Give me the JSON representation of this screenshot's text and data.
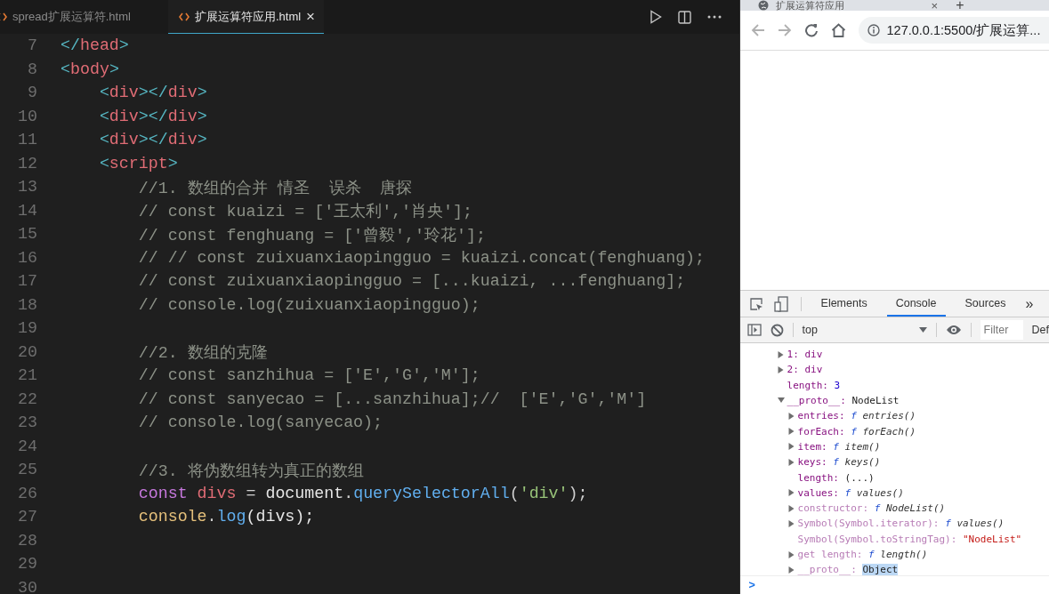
{
  "editor": {
    "tabs": [
      {
        "label": "spread扩展运算符.html",
        "selected": false,
        "closable": false
      },
      {
        "label": "扩展运算符应用.html",
        "selected": true,
        "closable": true,
        "close": "×"
      }
    ],
    "lines": [
      {
        "number": "7",
        "tokens": [
          {
            "text": "</",
            "kind": "bracket"
          },
          {
            "text": "head",
            "kind": "tag"
          },
          {
            "text": ">",
            "kind": "bracket"
          }
        ]
      },
      {
        "number": "8",
        "tokens": [
          {
            "text": "<",
            "kind": "bracket"
          },
          {
            "text": "body",
            "kind": "tag"
          },
          {
            "text": ">",
            "kind": "bracket"
          }
        ]
      },
      {
        "number": "9",
        "tokens": [
          {
            "text": "    <",
            "kind": "bracket"
          },
          {
            "text": "div",
            "kind": "tag"
          },
          {
            "text": "></",
            "kind": "bracket"
          },
          {
            "text": "div",
            "kind": "tag"
          },
          {
            "text": ">",
            "kind": "bracket"
          }
        ]
      },
      {
        "number": "10",
        "tokens": [
          {
            "text": "    <",
            "kind": "bracket"
          },
          {
            "text": "div",
            "kind": "tag"
          },
          {
            "text": "></",
            "kind": "bracket"
          },
          {
            "text": "div",
            "kind": "tag"
          },
          {
            "text": ">",
            "kind": "bracket"
          }
        ]
      },
      {
        "number": "11",
        "tokens": [
          {
            "text": "    <",
            "kind": "bracket"
          },
          {
            "text": "div",
            "kind": "tag"
          },
          {
            "text": "></",
            "kind": "bracket"
          },
          {
            "text": "div",
            "kind": "tag"
          },
          {
            "text": ">",
            "kind": "bracket"
          }
        ]
      },
      {
        "number": "12",
        "tokens": [
          {
            "text": "    <",
            "kind": "bracket"
          },
          {
            "text": "script",
            "kind": "tag"
          },
          {
            "text": ">",
            "kind": "bracket"
          }
        ]
      },
      {
        "number": "13",
        "tokens": [
          {
            "text": "        //1. 数组的合并 情圣  误杀  唐探",
            "kind": "comment"
          }
        ]
      },
      {
        "number": "14",
        "tokens": [
          {
            "text": "        // const kuaizi = ['王太利','肖央'];",
            "kind": "comment"
          }
        ]
      },
      {
        "number": "15",
        "tokens": [
          {
            "text": "        // const fenghuang = ['曾毅','玲花'];",
            "kind": "comment"
          }
        ]
      },
      {
        "number": "16",
        "tokens": [
          {
            "text": "        // // const zuixuanxiaopingguo = kuaizi.concat(fenghuang);",
            "kind": "comment"
          }
        ]
      },
      {
        "number": "17",
        "tokens": [
          {
            "text": "        // const zuixuanxiaopingguo = [...kuaizi, ...fenghuang];",
            "kind": "comment"
          }
        ]
      },
      {
        "number": "18",
        "tokens": [
          {
            "text": "        // console.log(zuixuanxiaopingguo);",
            "kind": "comment"
          }
        ]
      },
      {
        "number": "19"
      },
      {
        "number": "20",
        "tokens": [
          {
            "text": "        //2. 数组的克隆",
            "kind": "comment"
          }
        ]
      },
      {
        "number": "21",
        "tokens": [
          {
            "text": "        // const sanzhihua = ['E','G','M'];",
            "kind": "comment"
          }
        ]
      },
      {
        "number": "22",
        "tokens": [
          {
            "text": "        // const sanyecao = [...sanzhihua];//  ['E','G','M']",
            "kind": "comment"
          }
        ]
      },
      {
        "number": "23",
        "tokens": [
          {
            "text": "        // console.log(sanyecao);",
            "kind": "comment"
          }
        ]
      },
      {
        "number": "24"
      },
      {
        "number": "25",
        "tokens": [
          {
            "text": "        //3. 将伪数组转为真正的数组",
            "kind": "comment"
          }
        ]
      },
      {
        "number": "26",
        "tokens": [
          {
            "text": "        const",
            "kind": "keyword"
          },
          {
            "text": " divs",
            "kind": "variable"
          },
          {
            "text": " = ",
            "kind": "punct"
          },
          {
            "text": "document",
            "kind": "plain"
          },
          {
            "text": ".",
            "kind": "punct"
          },
          {
            "text": "querySelectorAll",
            "kind": "method"
          },
          {
            "text": "(",
            "kind": "punct"
          },
          {
            "text": "'div'",
            "kind": "string"
          },
          {
            "text": ");",
            "kind": "punct"
          }
        ]
      },
      {
        "number": "27",
        "tokens": [
          {
            "text": "        console",
            "kind": "object"
          },
          {
            "text": ".",
            "kind": "punct"
          },
          {
            "text": "log",
            "kind": "method"
          },
          {
            "text": "(divs);",
            "kind": "plain"
          }
        ]
      },
      {
        "number": "28"
      },
      {
        "number": "29"
      },
      {
        "number": "30"
      }
    ]
  },
  "browser": {
    "tab_title": "扩展运算符应用",
    "tab_close": "×",
    "new_tab": "+",
    "url": "127.0.0.1:5500/扩展运算...",
    "devtools": {
      "tabs": [
        {
          "label": "Elements",
          "selected": false
        },
        {
          "label": "Console",
          "selected": true
        },
        {
          "label": "Sources",
          "selected": false
        }
      ],
      "more": "»",
      "context": "top",
      "filter_placeholder": "Filter",
      "levels": "Def",
      "entries": [
        {
          "key": "1:",
          "value": "div",
          "kind": "node",
          "expandable": true,
          "expanded": false,
          "dimmed": false,
          "highlighted": false
        },
        {
          "key": "2:",
          "value": "div",
          "kind": "node",
          "expandable": true,
          "expanded": false,
          "dimmed": false,
          "highlighted": false
        },
        {
          "key": "length:",
          "value": "3",
          "kind": "number",
          "expandable": false,
          "dimmed": false,
          "highlighted": false
        },
        {
          "key": "__proto__:",
          "value": "NodeList",
          "kind": "plain",
          "expandable": true,
          "expanded": true,
          "dimmed": false,
          "highlighted": false,
          "children": [
            {
              "key": "entries:",
              "prefix": "f",
              "value": "entries()",
              "kind": "function",
              "expandable": true,
              "expanded": false,
              "dimmed": false,
              "highlighted": false
            },
            {
              "key": "forEach:",
              "prefix": "f",
              "value": "forEach()",
              "kind": "function",
              "expandable": true,
              "expanded": false,
              "dimmed": false,
              "highlighted": false
            },
            {
              "key": "item:",
              "prefix": "f",
              "value": "item()",
              "kind": "function",
              "expandable": true,
              "expanded": false,
              "dimmed": false,
              "highlighted": false
            },
            {
              "key": "keys:",
              "prefix": "f",
              "value": "keys()",
              "kind": "function",
              "expandable": true,
              "expanded": false,
              "dimmed": false,
              "highlighted": false
            },
            {
              "key": "length:",
              "value": "(...)",
              "kind": "plain",
              "expandable": false,
              "dimmed": false,
              "highlighted": false
            },
            {
              "key": "values:",
              "prefix": "f",
              "value": "values()",
              "kind": "function",
              "expandable": true,
              "expanded": false,
              "dimmed": false,
              "highlighted": false
            },
            {
              "key": "constructor:",
              "prefix": "f",
              "value": "NodeList()",
              "kind": "function",
              "expandable": true,
              "expanded": false,
              "dimmed": true,
              "highlighted": false
            },
            {
              "key": "Symbol(Symbol.iterator):",
              "prefix": "f",
              "value": "values()",
              "kind": "function",
              "expandable": true,
              "expanded": false,
              "dimmed": true,
              "highlighted": false
            },
            {
              "key": "Symbol(Symbol.toStringTag):",
              "value": "\"NodeList\"",
              "kind": "string",
              "expandable": false,
              "dimmed": true,
              "highlighted": false
            },
            {
              "key": "get length:",
              "prefix": "f",
              "value": "length()",
              "kind": "function",
              "expandable": true,
              "expanded": false,
              "dimmed": true,
              "highlighted": false
            },
            {
              "key": "__proto__:",
              "value": "Object",
              "kind": "plain",
              "expandable": true,
              "expanded": false,
              "dimmed": true,
              "highlighted": true
            }
          ]
        }
      ],
      "prompt": ">"
    }
  }
}
